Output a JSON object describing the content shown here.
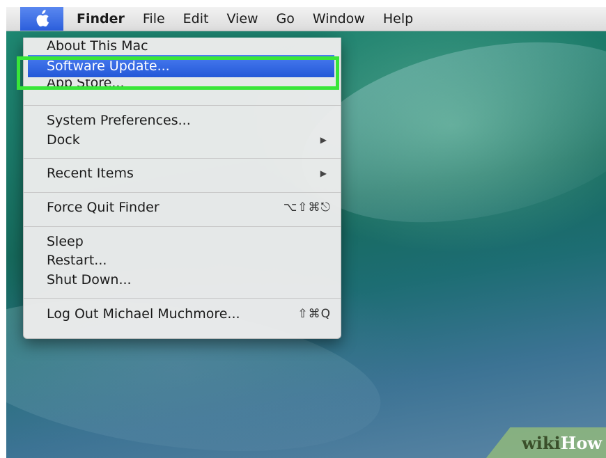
{
  "menubar": {
    "apple_icon": "apple-logo-icon",
    "app_name": "Finder",
    "items": [
      "File",
      "Edit",
      "View",
      "Go",
      "Window",
      "Help"
    ]
  },
  "apple_menu": {
    "about": "About This Mac",
    "software_update": "Software Update...",
    "app_store": "App Store...",
    "system_preferences": "System Preferences...",
    "dock": "Dock",
    "recent_items": "Recent Items",
    "force_quit": "Force Quit Finder",
    "force_quit_shortcut": "⌥⇧⌘⎋",
    "sleep": "Sleep",
    "restart": "Restart...",
    "shut_down": "Shut Down...",
    "log_out": "Log Out Michael Muchmore...",
    "log_out_shortcut": "⇧⌘Q",
    "submenu_arrow": "▶"
  },
  "watermark": {
    "part1": "wiki",
    "part2": "How"
  },
  "colors": {
    "selection": "#2c5fdc",
    "highlight_box": "#39e639"
  }
}
